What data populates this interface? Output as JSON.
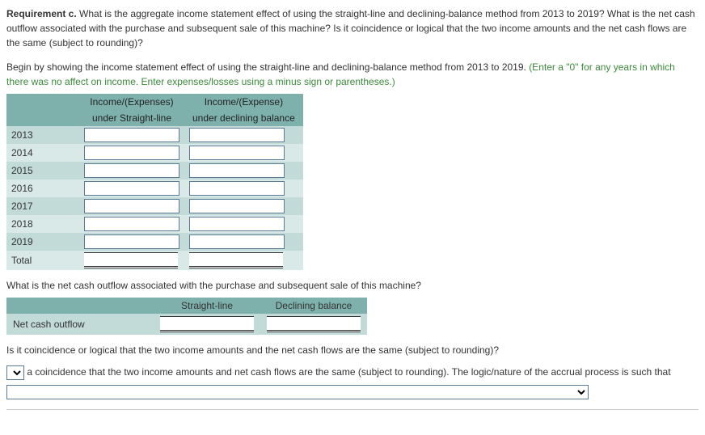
{
  "requirement": {
    "label": "Requirement c.",
    "text": " What is the aggregate income statement effect of using the straight-line and declining-balance method from 2013 to 2019? What is the net cash outflow associated with the purchase and subsequent sale of this machine? Is it coincidence or logical that the two income amounts and the net cash flows are the same (subject to rounding)?"
  },
  "instruction": {
    "plain": "Begin by showing the income statement effect of using the straight-line and declining-balance method from 2013 to 2019. ",
    "green": "(Enter a \"0\" for any years in which there was no affect on income. Enter expenses/losses using a minus sign or parentheses.)"
  },
  "table1": {
    "header": {
      "col1_line1": "Income/(Expenses)",
      "col1_line2": "under Straight-line",
      "col2_line1": "Income/(Expense)",
      "col2_line2": "under declining balance"
    },
    "rows": [
      {
        "year": "2013"
      },
      {
        "year": "2014"
      },
      {
        "year": "2015"
      },
      {
        "year": "2016"
      },
      {
        "year": "2017"
      },
      {
        "year": "2018"
      },
      {
        "year": "2019"
      }
    ],
    "total_label": "Total"
  },
  "subq1": "What is the net cash outflow associated with the purchase and subsequent sale of this machine?",
  "table2": {
    "header": {
      "col1": "Straight-line",
      "col2": "Declining balance"
    },
    "row_label": "Net cash outflow"
  },
  "subq2": "Is it coincidence or logical that the two income amounts and the net cash flows are the same (subject to rounding)?",
  "sentence": {
    "mid": " a coincidence that the two income amounts and net cash flows are the same (subject to rounding). The logic/nature of the accrual process is such that "
  }
}
